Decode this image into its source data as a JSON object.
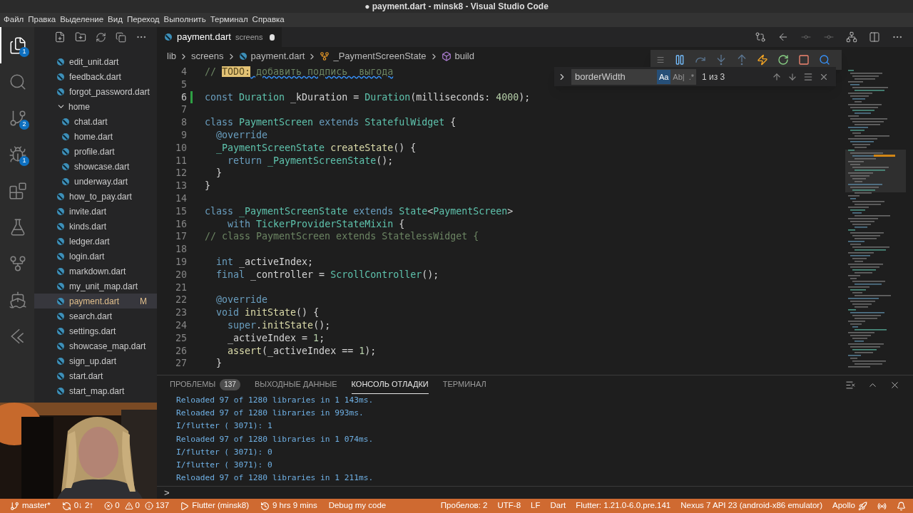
{
  "window": {
    "title": "● payment.dart - minsk8 - Visual Studio Code"
  },
  "menu": [
    "Файл",
    "Правка",
    "Выделение",
    "Вид",
    "Переход",
    "Выполнить",
    "Терминал",
    "Справка"
  ],
  "activity_bar": [
    {
      "selected": true,
      "badge": "1"
    },
    {
      "selected": false
    },
    {
      "selected": false,
      "badge": "2"
    },
    {
      "selected": false,
      "badge": "1"
    },
    {
      "selected": false
    },
    {
      "selected": false
    },
    {
      "selected": false
    },
    {
      "selected": false
    },
    {
      "selected": false
    }
  ],
  "explorer": {
    "items": [
      {
        "kind": "file",
        "name": "edit_unit.dart",
        "selected": false
      },
      {
        "kind": "file",
        "name": "feedback.dart",
        "selected": false
      },
      {
        "kind": "file",
        "name": "forgot_password.dart",
        "selected": false
      },
      {
        "kind": "folder",
        "name": "home",
        "selected": false,
        "expanded": true,
        "children": [
          {
            "kind": "file",
            "name": "chat.dart",
            "selected": false
          },
          {
            "kind": "file",
            "name": "home.dart",
            "selected": false
          },
          {
            "kind": "file",
            "name": "profile.dart",
            "selected": false
          },
          {
            "kind": "file",
            "name": "showcase.dart",
            "selected": false
          },
          {
            "kind": "file",
            "name": "underway.dart",
            "selected": false
          }
        ]
      },
      {
        "kind": "file",
        "name": "how_to_pay.dart",
        "selected": false
      },
      {
        "kind": "file",
        "name": "invite.dart",
        "selected": false
      },
      {
        "kind": "file",
        "name": "kinds.dart",
        "selected": false
      },
      {
        "kind": "file",
        "name": "ledger.dart",
        "selected": false
      },
      {
        "kind": "file",
        "name": "login.dart",
        "selected": false
      },
      {
        "kind": "file",
        "name": "markdown.dart",
        "selected": false
      },
      {
        "kind": "file",
        "name": "my_unit_map.dart",
        "selected": false
      },
      {
        "kind": "file",
        "name": "payment.dart",
        "selected": true,
        "status": "M"
      },
      {
        "kind": "file",
        "name": "search.dart",
        "selected": false
      },
      {
        "kind": "file",
        "name": "settings.dart",
        "selected": false
      },
      {
        "kind": "file",
        "name": "showcase_map.dart",
        "selected": false
      },
      {
        "kind": "file",
        "name": "sign_up.dart",
        "selected": false
      },
      {
        "kind": "file",
        "name": "start.dart",
        "selected": false
      },
      {
        "kind": "file",
        "name": "start_map.dart",
        "selected": false
      }
    ]
  },
  "webcam": {
    "kind": "picture"
  },
  "editor": {
    "tab": {
      "label": "payment.dart",
      "description": "screens",
      "dirty": true
    },
    "breadcrumbs": [
      {
        "kind": "folder",
        "text": "lib"
      },
      {
        "kind": "folder",
        "text": "screens"
      },
      {
        "kind": "file",
        "text": "payment.dart"
      },
      {
        "kind": "class",
        "text": "_PaymentScreenState"
      },
      {
        "kind": "method",
        "text": "build"
      }
    ],
    "lines": [
      {
        "number": "4",
        "modified": false,
        "tokens": [
          {
            "kind": "comment",
            "text": "// "
          },
          {
            "kind": "todo",
            "text": "TODO:"
          },
          {
            "kind": "squiggle",
            "text": " добавить подпись  выгода"
          }
        ]
      },
      {
        "number": "5",
        "modified": false
      },
      {
        "number": "6",
        "modified": true,
        "tokens": [
          {
            "kind": "kw",
            "text": "const "
          },
          {
            "kind": "type",
            "text": "Duration"
          },
          {
            "kind": "plain",
            "text": " _kDuration = "
          },
          {
            "kind": "type",
            "text": "Duration"
          },
          {
            "kind": "plain",
            "text": "(milliseconds: "
          },
          {
            "kind": "num",
            "text": "4000"
          },
          {
            "kind": "plain",
            "text": ");"
          }
        ]
      },
      {
        "number": "7",
        "modified": false
      },
      {
        "number": "8",
        "modified": false,
        "tokens": [
          {
            "kind": "kw",
            "text": "class "
          },
          {
            "kind": "type",
            "text": "PaymentScreen"
          },
          {
            "kind": "kw",
            "text": " extends "
          },
          {
            "kind": "type",
            "text": "StatefulWidget"
          },
          {
            "kind": "plain",
            "text": " {"
          }
        ]
      },
      {
        "number": "9",
        "modified": false,
        "tokens": [
          {
            "kind": "ann",
            "text": "  @override"
          }
        ]
      },
      {
        "number": "10",
        "modified": false,
        "tokens": [
          {
            "kind": "type",
            "text": "  _PaymentScreenState "
          },
          {
            "kind": "fn",
            "text": "createState"
          },
          {
            "kind": "plain",
            "text": "() {"
          }
        ]
      },
      {
        "number": "11",
        "modified": false,
        "tokens": [
          {
            "kind": "kw",
            "text": "    return "
          },
          {
            "kind": "type",
            "text": "_PaymentScreenState"
          },
          {
            "kind": "plain",
            "text": "();"
          }
        ]
      },
      {
        "number": "12",
        "modified": false,
        "tokens": [
          {
            "kind": "plain",
            "text": "  }"
          }
        ]
      },
      {
        "number": "13",
        "modified": false,
        "tokens": [
          {
            "kind": "plain",
            "text": "}"
          }
        ]
      },
      {
        "number": "14",
        "modified": false
      },
      {
        "number": "15",
        "modified": false,
        "tokens": [
          {
            "kind": "kw",
            "text": "class "
          },
          {
            "kind": "type",
            "text": "_PaymentScreenState"
          },
          {
            "kind": "kw",
            "text": " extends "
          },
          {
            "kind": "type",
            "text": "State"
          },
          {
            "kind": "plain",
            "text": "<"
          },
          {
            "kind": "type",
            "text": "PaymentScreen"
          },
          {
            "kind": "plain",
            "text": ">"
          }
        ]
      },
      {
        "number": "16",
        "modified": false,
        "tokens": [
          {
            "kind": "kw",
            "text": "    with "
          },
          {
            "kind": "type",
            "text": "TickerProviderStateMixin"
          },
          {
            "kind": "plain",
            "text": " {"
          }
        ]
      },
      {
        "number": "17",
        "modified": false,
        "tokens": [
          {
            "kind": "comment",
            "text": "// class PaymentScreen extends StatelessWidget {"
          }
        ]
      },
      {
        "number": "18",
        "modified": false
      },
      {
        "number": "19",
        "modified": false,
        "tokens": [
          {
            "kind": "kw",
            "text": "  int "
          },
          {
            "kind": "plain",
            "text": "_activeIndex;"
          }
        ]
      },
      {
        "number": "20",
        "modified": false,
        "tokens": [
          {
            "kind": "kw",
            "text": "  final "
          },
          {
            "kind": "plain",
            "text": "_controller = "
          },
          {
            "kind": "type",
            "text": "ScrollController"
          },
          {
            "kind": "plain",
            "text": "();"
          }
        ]
      },
      {
        "number": "21",
        "modified": false
      },
      {
        "number": "22",
        "modified": false,
        "tokens": [
          {
            "kind": "ann",
            "text": "  @override"
          }
        ]
      },
      {
        "number": "23",
        "modified": false,
        "tokens": [
          {
            "kind": "kw",
            "text": "  void "
          },
          {
            "kind": "fn",
            "text": "initState"
          },
          {
            "kind": "plain",
            "text": "() {"
          }
        ]
      },
      {
        "number": "24",
        "modified": false,
        "tokens": [
          {
            "kind": "kw",
            "text": "    super"
          },
          {
            "kind": "plain",
            "text": "."
          },
          {
            "kind": "fn",
            "text": "initState"
          },
          {
            "kind": "plain",
            "text": "();"
          }
        ]
      },
      {
        "number": "25",
        "modified": false,
        "tokens": [
          {
            "kind": "plain",
            "text": "    _activeIndex = "
          },
          {
            "kind": "num",
            "text": "1"
          },
          {
            "kind": "plain",
            "text": ";"
          }
        ]
      },
      {
        "number": "26",
        "modified": false,
        "tokens": [
          {
            "kind": "fn",
            "text": "    assert"
          },
          {
            "kind": "plain",
            "text": "(_activeIndex == "
          },
          {
            "kind": "num",
            "text": "1"
          },
          {
            "kind": "plain",
            "text": ");"
          }
        ]
      },
      {
        "number": "27",
        "modified": false,
        "tokens": [
          {
            "kind": "plain",
            "text": "  }"
          }
        ]
      }
    ],
    "find": {
      "value": "borderWidth",
      "toggles": [
        {
          "label": "Aa",
          "on": true
        },
        {
          "label": "Ab|",
          "on": false
        },
        {
          "label": ".*",
          "on": false
        }
      ],
      "count": "1 из 3"
    }
  },
  "panel": {
    "tabs": [
      {
        "label": "ПРОБЛЕМЫ",
        "badge": "137",
        "selected": false
      },
      {
        "label": "ВЫХОДНЫЕ ДАННЫЕ",
        "selected": false
      },
      {
        "label": "КОНСОЛЬ ОТЛАДКИ",
        "selected": true
      },
      {
        "label": "ТЕРМИНАЛ",
        "selected": false
      }
    ],
    "console": [
      "Reloaded 97 of 1280 libraries in 1 143ms.",
      "Reloaded 97 of 1280 libraries in 993ms.",
      "I/flutter ( 3071): 1",
      "Reloaded 97 of 1280 libraries in 1 074ms.",
      "I/flutter ( 3071): 0",
      "I/flutter ( 3071): 0",
      "Reloaded 97 of 1280 libraries in 1 211ms."
    ],
    "prompt": ">"
  },
  "status_bar": {
    "left": [
      {
        "kind": "branch",
        "text": "master*"
      },
      {
        "kind": "sync",
        "text": "0↓ 2↑"
      },
      {
        "kind": "problems",
        "errors": "0",
        "warnings": "0",
        "infos": "137"
      },
      {
        "kind": "play",
        "text": "Flutter (minsk8)"
      },
      {
        "kind": "history",
        "text": "9 hrs 9 mins"
      },
      {
        "kind": "plain",
        "text": "Debug my code"
      }
    ],
    "right": [
      {
        "kind": "plain",
        "text": "Пробелов: 2"
      },
      {
        "kind": "plain",
        "text": "UTF-8"
      },
      {
        "kind": "plain",
        "text": "LF"
      },
      {
        "kind": "plain",
        "text": "Dart"
      },
      {
        "kind": "plain",
        "text": "Flutter: 1.21.0-6.0.pre.141"
      },
      {
        "kind": "plain",
        "text": "Nexus 7 API 23 (android-x86 emulator)"
      },
      {
        "kind": "rocket",
        "text": "Apollo"
      },
      {
        "kind": "broadcast"
      },
      {
        "kind": "bell"
      }
    ]
  }
}
